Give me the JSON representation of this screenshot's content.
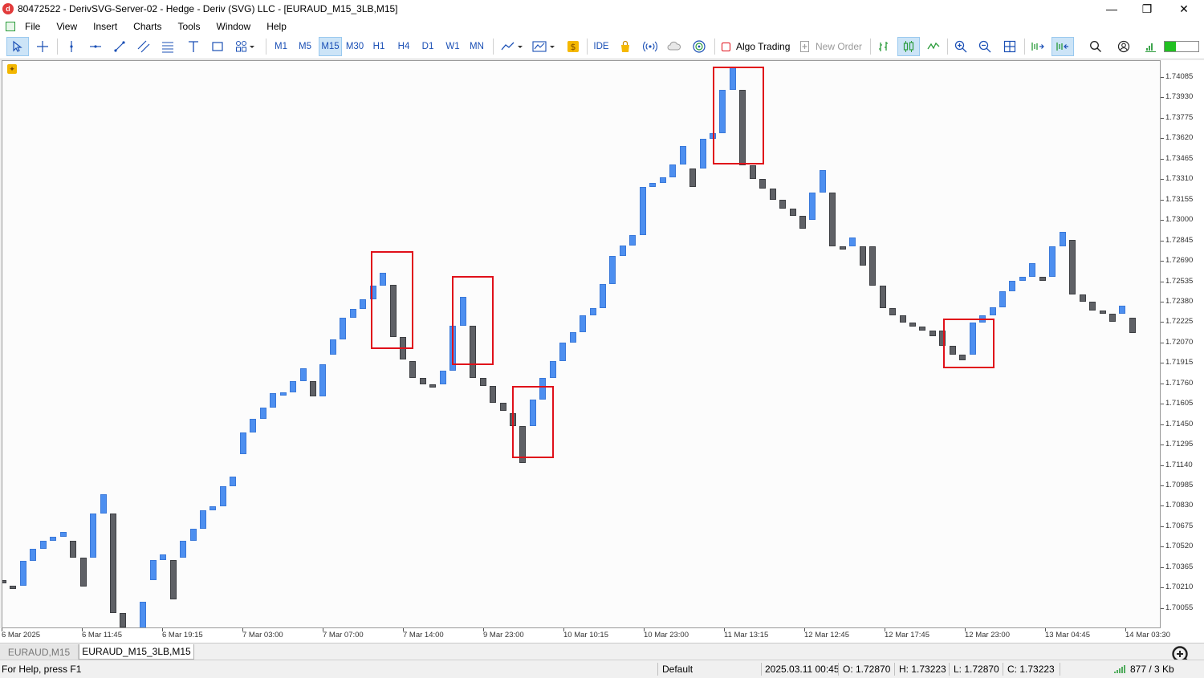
{
  "window": {
    "title": "80472522 - DerivSVG-Server-02 - Hedge - Deriv (SVG) LLC - [EURAUD_M15_3LB,M15]",
    "minimize": "—",
    "maximize": "❐",
    "close": "✕"
  },
  "menu": [
    "File",
    "View",
    "Insert",
    "Charts",
    "Tools",
    "Window",
    "Help"
  ],
  "toolbar": {
    "timeframes": [
      "M1",
      "M5",
      "M15",
      "M30",
      "H1",
      "H4",
      "D1",
      "W1",
      "MN"
    ],
    "active_timeframe": "M15",
    "ide_label": "IDE",
    "algo_trading_label": "Algo Trading",
    "new_order_label": "New Order"
  },
  "chart": {
    "symbol": "EURAUD_M15_3LB",
    "bull_color": "#4d8ff0",
    "bear_color": "#5f6166",
    "marker_color": "#e0101a",
    "price_labels": [
      "1.74085",
      "1.73930",
      "1.73775",
      "1.73620",
      "1.73465",
      "1.73310",
      "1.73155",
      "1.73000",
      "1.72845",
      "1.72690",
      "1.72535",
      "1.72380",
      "1.72225",
      "1.72070",
      "1.71915",
      "1.71760",
      "1.71605",
      "1.71450",
      "1.71295",
      "1.71140",
      "1.70985",
      "1.70830",
      "1.70675",
      "1.70520",
      "1.70365",
      "1.70210",
      "1.70055"
    ],
    "time_labels": [
      "6 Mar 2025",
      "6 Mar 11:45",
      "6 Mar 19:15",
      "7 Mar 03:00",
      "7 Mar 07:00",
      "7 Mar 14:00",
      "9 Mar 23:00",
      "10 Mar 10:15",
      "10 Mar 23:00",
      "11 Mar 13:15",
      "12 Mar 12:45",
      "12 Mar 17:45",
      "12 Mar 23:00",
      "13 Mar 04:45",
      "14 Mar 03:30"
    ]
  },
  "chart_data": {
    "type": "renko-bricks",
    "bricks": [
      {
        "dir": "down",
        "open": 1.70275,
        "close": 1.7025
      },
      {
        "dir": "down",
        "open": 1.7023,
        "close": 1.70205
      },
      {
        "dir": "up",
        "open": 1.7023,
        "close": 1.7042
      },
      {
        "dir": "up",
        "open": 1.7042,
        "close": 1.7051
      },
      {
        "dir": "up",
        "open": 1.7051,
        "close": 1.7057
      },
      {
        "dir": "up",
        "open": 1.7057,
        "close": 1.706
      },
      {
        "dir": "up",
        "open": 1.706,
        "close": 1.7064
      },
      {
        "dir": "down",
        "open": 1.7057,
        "close": 1.7044
      },
      {
        "dir": "down",
        "open": 1.7044,
        "close": 1.70225
      },
      {
        "dir": "up",
        "open": 1.7044,
        "close": 1.7078
      },
      {
        "dir": "up",
        "open": 1.7078,
        "close": 1.70925
      },
      {
        "dir": "down",
        "open": 1.7078,
        "close": 1.7002
      },
      {
        "dir": "down",
        "open": 1.7002,
        "close": 1.6991
      },
      {
        "dir": "down",
        "open": 1.6991,
        "close": 1.6975
      },
      {
        "dir": "up",
        "open": 1.6989,
        "close": 1.70105
      },
      {
        "dir": "up",
        "open": 1.7027,
        "close": 1.70425
      },
      {
        "dir": "up",
        "open": 1.70425,
        "close": 1.70465
      },
      {
        "dir": "down",
        "open": 1.70425,
        "close": 1.70125
      },
      {
        "dir": "up",
        "open": 1.7044,
        "close": 1.7057
      },
      {
        "dir": "up",
        "open": 1.7057,
        "close": 1.7066
      },
      {
        "dir": "up",
        "open": 1.7066,
        "close": 1.70805
      },
      {
        "dir": "up",
        "open": 1.70805,
        "close": 1.7083
      },
      {
        "dir": "up",
        "open": 1.7083,
        "close": 1.70985
      },
      {
        "dir": "up",
        "open": 1.70985,
        "close": 1.7106
      },
      {
        "dir": "up",
        "open": 1.7123,
        "close": 1.71395
      },
      {
        "dir": "up",
        "open": 1.71395,
        "close": 1.71495
      },
      {
        "dir": "up",
        "open": 1.71495,
        "close": 1.7158
      },
      {
        "dir": "up",
        "open": 1.7158,
        "close": 1.7169
      },
      {
        "dir": "up",
        "open": 1.7169,
        "close": 1.717
      },
      {
        "dir": "up",
        "open": 1.717,
        "close": 1.71785
      },
      {
        "dir": "up",
        "open": 1.71785,
        "close": 1.7188
      },
      {
        "dir": "down",
        "open": 1.71785,
        "close": 1.7167
      },
      {
        "dir": "up",
        "open": 1.7167,
        "close": 1.7191
      },
      {
        "dir": "up",
        "open": 1.71985,
        "close": 1.721
      },
      {
        "dir": "up",
        "open": 1.721,
        "close": 1.72265
      },
      {
        "dir": "up",
        "open": 1.72265,
        "close": 1.7233
      },
      {
        "dir": "up",
        "open": 1.7233,
        "close": 1.72405
      },
      {
        "dir": "up",
        "open": 1.72405,
        "close": 1.72505
      },
      {
        "dir": "up",
        "open": 1.72505,
        "close": 1.72605
      },
      {
        "dir": "down",
        "open": 1.72515,
        "close": 1.7212
      },
      {
        "dir": "down",
        "open": 1.7212,
        "close": 1.71945
      },
      {
        "dir": "down",
        "open": 1.71935,
        "close": 1.7181
      },
      {
        "dir": "down",
        "open": 1.7181,
        "close": 1.7176
      },
      {
        "dir": "down",
        "open": 1.7176,
        "close": 1.7174
      },
      {
        "dir": "up",
        "open": 1.7176,
        "close": 1.7186
      },
      {
        "dir": "up",
        "open": 1.7186,
        "close": 1.72205
      },
      {
        "dir": "up",
        "open": 1.72205,
        "close": 1.7242
      },
      {
        "dir": "down",
        "open": 1.72205,
        "close": 1.71805
      },
      {
        "dir": "down",
        "open": 1.71805,
        "close": 1.71745
      },
      {
        "dir": "down",
        "open": 1.71745,
        "close": 1.7162
      },
      {
        "dir": "down",
        "open": 1.7162,
        "close": 1.7156
      },
      {
        "dir": "down",
        "open": 1.7154,
        "close": 1.7144
      },
      {
        "dir": "down",
        "open": 1.7144,
        "close": 1.7116
      },
      {
        "dir": "up",
        "open": 1.7144,
        "close": 1.7164
      },
      {
        "dir": "up",
        "open": 1.7164,
        "close": 1.7181
      },
      {
        "dir": "up",
        "open": 1.7181,
        "close": 1.71935
      },
      {
        "dir": "up",
        "open": 1.71935,
        "close": 1.72075
      },
      {
        "dir": "up",
        "open": 1.72075,
        "close": 1.72155
      },
      {
        "dir": "up",
        "open": 1.72155,
        "close": 1.7228
      },
      {
        "dir": "up",
        "open": 1.7228,
        "close": 1.72335
      },
      {
        "dir": "up",
        "open": 1.72335,
        "close": 1.7252
      },
      {
        "dir": "up",
        "open": 1.7252,
        "close": 1.72735
      },
      {
        "dir": "up",
        "open": 1.72735,
        "close": 1.72815
      },
      {
        "dir": "up",
        "open": 1.72815,
        "close": 1.7289
      },
      {
        "dir": "up",
        "open": 1.7289,
        "close": 1.73255
      },
      {
        "dir": "up",
        "open": 1.73255,
        "close": 1.7329
      },
      {
        "dir": "up",
        "open": 1.7329,
        "close": 1.7333
      },
      {
        "dir": "up",
        "open": 1.7333,
        "close": 1.7343
      },
      {
        "dir": "up",
        "open": 1.7343,
        "close": 1.7357
      },
      {
        "dir": "down",
        "open": 1.73395,
        "close": 1.73255
      },
      {
        "dir": "up",
        "open": 1.73395,
        "close": 1.73625
      },
      {
        "dir": "up",
        "open": 1.73625,
        "close": 1.73665
      },
      {
        "dir": "up",
        "open": 1.73665,
        "close": 1.73995
      },
      {
        "dir": "up",
        "open": 1.73995,
        "close": 1.74165
      },
      {
        "dir": "down",
        "open": 1.73995,
        "close": 1.7342
      },
      {
        "dir": "down",
        "open": 1.7342,
        "close": 1.7332
      },
      {
        "dir": "down",
        "open": 1.7332,
        "close": 1.73245
      },
      {
        "dir": "down",
        "open": 1.73245,
        "close": 1.7316
      },
      {
        "dir": "down",
        "open": 1.7316,
        "close": 1.7309
      },
      {
        "dir": "down",
        "open": 1.7309,
        "close": 1.7304
      },
      {
        "dir": "down",
        "open": 1.7304,
        "close": 1.7294
      },
      {
        "dir": "up",
        "open": 1.7301,
        "close": 1.73215
      },
      {
        "dir": "up",
        "open": 1.73215,
        "close": 1.73385
      },
      {
        "dir": "down",
        "open": 1.73215,
        "close": 1.72805
      },
      {
        "dir": "down",
        "open": 1.72805,
        "close": 1.7279
      },
      {
        "dir": "up",
        "open": 1.72805,
        "close": 1.7287
      },
      {
        "dir": "down",
        "open": 1.72805,
        "close": 1.7266
      },
      {
        "dir": "down",
        "open": 1.72805,
        "close": 1.72505
      },
      {
        "dir": "down",
        "open": 1.72505,
        "close": 1.72335
      },
      {
        "dir": "down",
        "open": 1.72335,
        "close": 1.72285
      },
      {
        "dir": "down",
        "open": 1.72285,
        "close": 1.72225
      },
      {
        "dir": "down",
        "open": 1.72225,
        "close": 1.72195
      },
      {
        "dir": "down",
        "open": 1.72195,
        "close": 1.72165
      },
      {
        "dir": "down",
        "open": 1.72165,
        "close": 1.72125
      },
      {
        "dir": "down",
        "open": 1.72165,
        "close": 1.7205
      },
      {
        "dir": "down",
        "open": 1.7205,
        "close": 1.71985
      },
      {
        "dir": "down",
        "open": 1.71985,
        "close": 1.7194
      },
      {
        "dir": "up",
        "open": 1.71985,
        "close": 1.72225
      },
      {
        "dir": "up",
        "open": 1.72225,
        "close": 1.7228
      },
      {
        "dir": "up",
        "open": 1.7228,
        "close": 1.72345
      },
      {
        "dir": "up",
        "open": 1.72345,
        "close": 1.72465
      },
      {
        "dir": "up",
        "open": 1.72465,
        "close": 1.72545
      },
      {
        "dir": "up",
        "open": 1.72545,
        "close": 1.72575
      },
      {
        "dir": "up",
        "open": 1.72575,
        "close": 1.7268
      },
      {
        "dir": "down",
        "open": 1.72575,
        "close": 1.72545
      },
      {
        "dir": "up",
        "open": 1.72575,
        "close": 1.72805
      },
      {
        "dir": "up",
        "open": 1.72805,
        "close": 1.72915
      },
      {
        "dir": "down",
        "open": 1.72855,
        "close": 1.7244
      },
      {
        "dir": "down",
        "open": 1.7244,
        "close": 1.72385
      },
      {
        "dir": "down",
        "open": 1.72385,
        "close": 1.7232
      },
      {
        "dir": "down",
        "open": 1.7232,
        "close": 1.72295
      },
      {
        "dir": "down",
        "open": 1.72295,
        "close": 1.72235
      },
      {
        "dir": "up",
        "open": 1.72295,
        "close": 1.72355
      },
      {
        "dir": "down",
        "open": 1.72265,
        "close": 1.7215
      }
    ],
    "markers": [
      {
        "from": 1.7277,
        "to": 1.72025
      },
      {
        "from": 1.7258,
        "to": 1.71905
      },
      {
        "from": 1.71745,
        "to": 1.712
      },
      {
        "from": 1.7417,
        "to": 1.73425
      },
      {
        "from": 1.72255,
        "to": 1.7188
      }
    ]
  },
  "tabs": [
    "EURAUD,M15",
    "EURAUD_M15_3LB,M15"
  ],
  "status": {
    "help": "For Help, press F1",
    "profile": "Default",
    "datetime": "2025.03.11 00:45",
    "open": "O: 1.72870",
    "high": "H: 1.73223",
    "low": "L: 1.72870",
    "close": "C: 1.73223",
    "traffic": "877 / 3 Kb"
  }
}
